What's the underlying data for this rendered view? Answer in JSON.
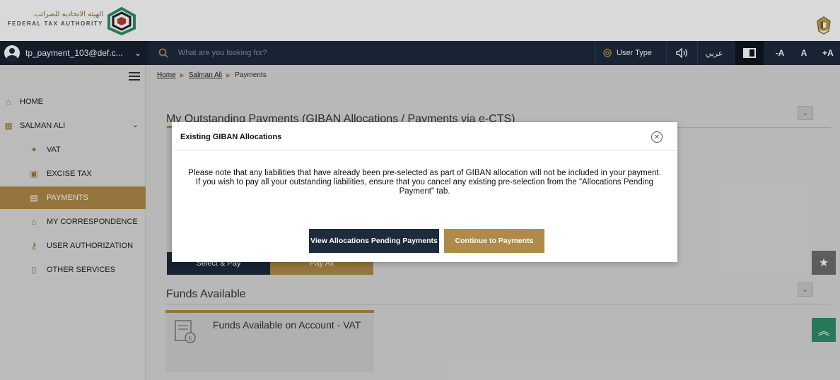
{
  "header": {
    "logo_ar": "الهيئة الاتحادية للضرائب",
    "logo_en": "FEDERAL TAX AUTHORITY"
  },
  "navbar": {
    "user_email": "tp_payment_103@def.c...",
    "search_placeholder": "What are you looking for?",
    "user_type_label": "User Type",
    "arabic_label": "عربي",
    "font_decrease": "-A",
    "font_normal": "A",
    "font_increase": "+A"
  },
  "sidebar": {
    "items": [
      {
        "label": "HOME"
      },
      {
        "label": "SALMAN ALI"
      },
      {
        "label": "VAT"
      },
      {
        "label": "EXCISE TAX"
      },
      {
        "label": "PAYMENTS"
      },
      {
        "label": "MY CORRESPONDENCE"
      },
      {
        "label": "USER AUTHORIZATION"
      },
      {
        "label": "OTHER SERVICES"
      }
    ]
  },
  "breadcrumb": {
    "home": "Home",
    "user": "Salman Ali",
    "current": "Payments"
  },
  "main": {
    "outstanding_title": "My Outstanding Payments (GIBAN Allocations / Payments via e-CTS)",
    "select_pay_label": "Select & Pay",
    "pay_all_label": "Pay All",
    "funds_title": "Funds Available",
    "funds_card_label": "Funds Available on Account - VAT"
  },
  "modal": {
    "title": "Existing GIBAN Allocations",
    "body": "Please note that any liabilities that have already been pre-selected as part of GIBAN allocation will not be included in your payment. If you wish to pay all your outstanding liabilities, ensure that you cancel any existing pre-selection from the \"Allocations Pending Payment\" tab.",
    "view_button": "View Allocations Pending Payments",
    "continue_button": "Continue to Payments"
  },
  "colors": {
    "gold": "#b08a48",
    "navy": "#1d2b3c",
    "sea_green": "#2f8f6a"
  }
}
